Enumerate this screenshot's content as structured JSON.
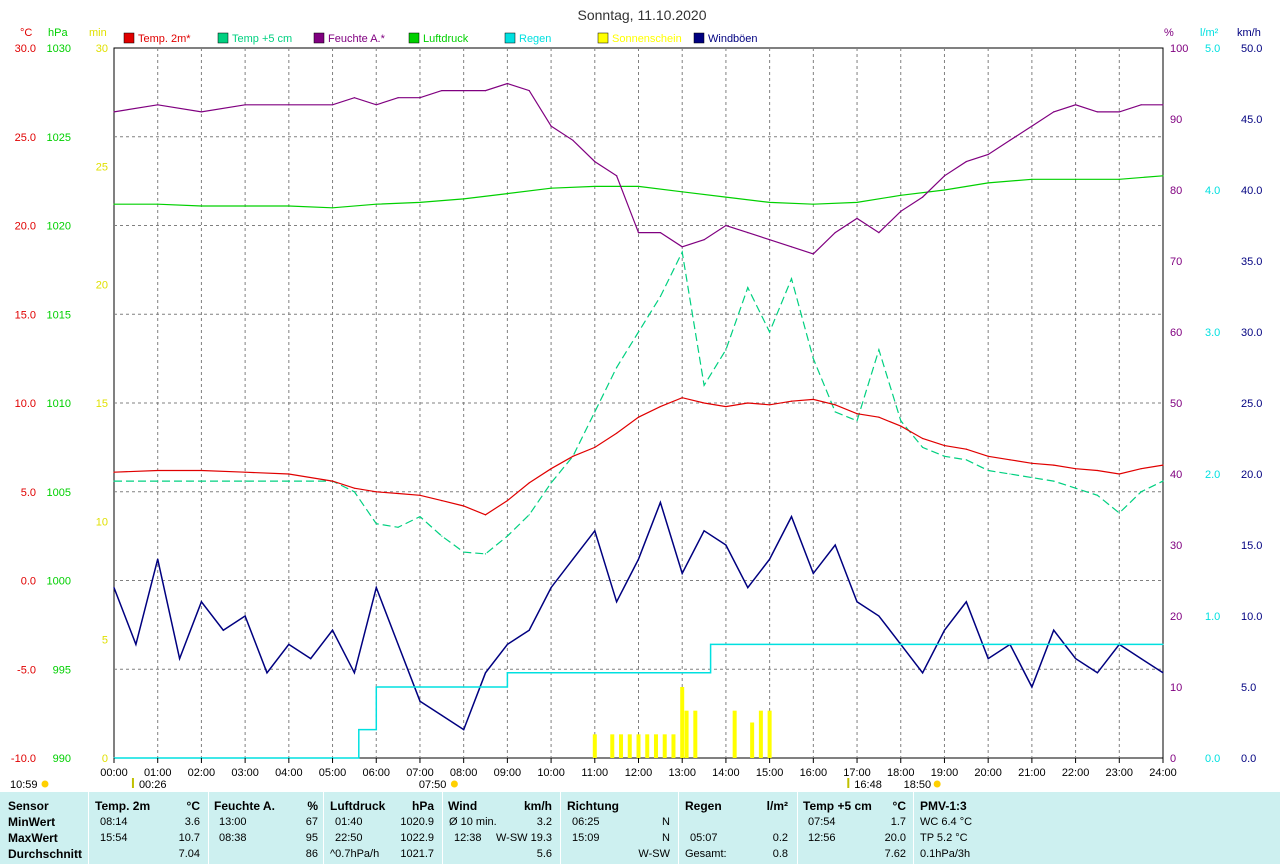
{
  "title": "Sonntag, 11.10.2020",
  "colors": {
    "temp2m": "#e00000",
    "temp5cm": "#00d080",
    "humidity": "#800080",
    "pressure": "#00d000",
    "rain": "#00e0e0",
    "sunshine": "#ffff00",
    "gusts": "#000080",
    "grid": "#808080"
  },
  "axis_units": {
    "temp": "°C",
    "pressure": "hPa",
    "sun": "min",
    "humidity": "%",
    "rain": "l/m²",
    "wind": "km/h"
  },
  "legend": [
    {
      "label": "Temp. 2m*",
      "color": "#e00000"
    },
    {
      "label": "Temp +5 cm",
      "color": "#00d080"
    },
    {
      "label": "Feuchte A.*",
      "color": "#800080"
    },
    {
      "label": "Luftdruck",
      "color": "#00d000"
    },
    {
      "label": "Regen",
      "color": "#00e0e0"
    },
    {
      "label": "Sonnenschein",
      "color": "#ffff00"
    },
    {
      "label": "Windböen",
      "color": "#000080"
    }
  ],
  "chart_data": {
    "type": "line",
    "title": "Sonntag, 11.10.2020",
    "x_ticks": [
      "00:00",
      "01:00",
      "02:00",
      "03:00",
      "04:00",
      "05:00",
      "06:00",
      "07:00",
      "08:00",
      "09:00",
      "10:00",
      "11:00",
      "12:00",
      "13:00",
      "14:00",
      "15:00",
      "16:00",
      "17:00",
      "18:00",
      "19:00",
      "20:00",
      "21:00",
      "22:00",
      "23:00",
      "24:00"
    ],
    "xlim_hours": [
      0,
      24
    ],
    "axes": {
      "temp": {
        "range": [
          -10,
          30
        ],
        "ticks": [
          "30.0",
          "25.0",
          "20.0",
          "15.0",
          "10.0",
          "5.0",
          "0.0",
          "-5.0",
          "-10.0"
        ]
      },
      "pressure": {
        "range": [
          990,
          1030
        ],
        "ticks": [
          "1030",
          "1025",
          "1020",
          "1015",
          "1010",
          "1005",
          "1000",
          "995",
          "990"
        ]
      },
      "sun": {
        "range": [
          0,
          30
        ],
        "ticks": [
          "30",
          "25",
          "20",
          "15",
          "10",
          "5",
          "0"
        ]
      },
      "humidity": {
        "range": [
          0,
          100
        ],
        "ticks": [
          "100",
          "90",
          "80",
          "70",
          "60",
          "50",
          "40",
          "30",
          "20",
          "10",
          "0"
        ]
      },
      "rain": {
        "range": [
          0,
          5
        ],
        "ticks": [
          "5.0",
          "4.0",
          "3.0",
          "2.0",
          "1.0",
          "0.0"
        ]
      },
      "wind": {
        "range": [
          0,
          50
        ],
        "ticks": [
          "50.0",
          "45.0",
          "40.0",
          "35.0",
          "30.0",
          "25.0",
          "20.0",
          "15.0",
          "10.0",
          "5.0",
          "0.0"
        ]
      }
    },
    "grid": true,
    "sun_markers": {
      "sunrise": "07:50",
      "sunset": "18:50",
      "moonrise_left": "00:26",
      "moonset": "16:48",
      "daylength": "10:59"
    },
    "series": [
      {
        "name": "Temp. 2m*",
        "axis": "temp",
        "hours": [
          0,
          1,
          2,
          3,
          4,
          5,
          5.5,
          6,
          6.5,
          7,
          7.5,
          8,
          8.5,
          9,
          9.5,
          10,
          10.5,
          11,
          11.5,
          12,
          12.5,
          13,
          13.5,
          14,
          14.5,
          15,
          15.5,
          16,
          16.5,
          17,
          17.5,
          18,
          18.5,
          19,
          19.5,
          20,
          20.5,
          21,
          21.5,
          22,
          22.5,
          23,
          23.5,
          24
        ],
        "values": [
          6.1,
          6.2,
          6.2,
          6.1,
          6.0,
          5.6,
          5.2,
          5.0,
          4.9,
          4.8,
          4.5,
          4.2,
          3.7,
          4.5,
          5.5,
          6.3,
          7.0,
          7.5,
          8.3,
          9.2,
          9.8,
          10.3,
          10.0,
          9.8,
          10.0,
          9.9,
          10.1,
          10.2,
          9.9,
          9.4,
          9.2,
          8.7,
          8.0,
          7.6,
          7.4,
          7.0,
          6.8,
          6.6,
          6.5,
          6.3,
          6.2,
          6.0,
          6.3,
          6.5
        ]
      },
      {
        "name": "Temp +5 cm",
        "axis": "temp",
        "hours": [
          0,
          1,
          2,
          3,
          4,
          5,
          5.5,
          6,
          6.5,
          7,
          7.5,
          8,
          8.5,
          9,
          9.5,
          10,
          10.5,
          11,
          11.5,
          12,
          12.5,
          13,
          13.5,
          14,
          14.5,
          15,
          15.5,
          16,
          16.5,
          17,
          17.5,
          18,
          18.5,
          19,
          19.5,
          20,
          20.5,
          21,
          21.5,
          22,
          22.5,
          23,
          23.5,
          24
        ],
        "values": [
          5.6,
          5.6,
          5.6,
          5.6,
          5.6,
          5.6,
          5.0,
          3.2,
          3.0,
          3.6,
          2.5,
          1.6,
          1.5,
          2.5,
          3.7,
          5.5,
          7.0,
          9.5,
          12.0,
          14.0,
          16.0,
          18.5,
          11.0,
          13.0,
          16.5,
          14.0,
          17.0,
          12.5,
          9.5,
          9.0,
          13.0,
          9.0,
          7.5,
          7.0,
          6.8,
          6.2,
          6.0,
          5.8,
          5.6,
          5.2,
          4.8,
          3.8,
          5.0,
          5.6
        ]
      },
      {
        "name": "Feuchte A.*",
        "axis": "humidity",
        "hours": [
          0,
          1,
          2,
          3,
          4,
          5,
          5.5,
          6,
          6.5,
          7,
          7.5,
          8,
          8.5,
          9,
          9.5,
          10,
          10.5,
          11,
          11.5,
          12,
          12.5,
          13,
          13.5,
          14,
          14.5,
          15,
          15.5,
          16,
          16.5,
          17,
          17.5,
          18,
          18.5,
          19,
          19.5,
          20,
          20.5,
          21,
          21.5,
          22,
          22.5,
          23,
          23.5,
          24
        ],
        "values": [
          91,
          92,
          91,
          92,
          92,
          92,
          93,
          92,
          93,
          93,
          94,
          94,
          94,
          95,
          94,
          89,
          87,
          84,
          82,
          74,
          74,
          72,
          73,
          75,
          74,
          73,
          72,
          71,
          74,
          76,
          74,
          77,
          79,
          82,
          84,
          85,
          87,
          89,
          91,
          92,
          91,
          91,
          92,
          92
        ]
      },
      {
        "name": "Luftdruck",
        "axis": "pressure",
        "hours": [
          0,
          1,
          2,
          3,
          4,
          5,
          6,
          7,
          8,
          9,
          10,
          11,
          12,
          13,
          14,
          15,
          16,
          17,
          18,
          19,
          20,
          21,
          22,
          23,
          24
        ],
        "values": [
          1021.2,
          1021.2,
          1021.1,
          1021.1,
          1021.1,
          1021.0,
          1021.2,
          1021.3,
          1021.5,
          1021.8,
          1022.1,
          1022.2,
          1022.2,
          1021.9,
          1021.6,
          1021.3,
          1021.2,
          1021.3,
          1021.7,
          1022.0,
          1022.4,
          1022.6,
          1022.6,
          1022.6,
          1022.8
        ]
      },
      {
        "name": "Regen",
        "axis": "rain",
        "hours": [
          0,
          5,
          5.6,
          6.0,
          7.0,
          8.0,
          9.0,
          10.0,
          11.0,
          12.0,
          13.0,
          13.6,
          13.65,
          14,
          15,
          16,
          17,
          18,
          19,
          20,
          21,
          22,
          23,
          24
        ],
        "values": [
          0,
          0,
          0.2,
          0.5,
          0.5,
          0.5,
          0.6,
          0.6,
          0.6,
          0.6,
          0.6,
          0.6,
          0.8,
          0.8,
          0.8,
          0.8,
          0.8,
          0.8,
          0.8,
          0.8,
          0.8,
          0.8,
          0.8,
          0.8
        ]
      },
      {
        "name": "Sonnenschein",
        "axis": "sun",
        "type": "bar",
        "hours": [
          11.0,
          11.4,
          11.6,
          11.8,
          12.0,
          12.2,
          12.4,
          12.6,
          12.8,
          13.0,
          13.1,
          13.3,
          14.2,
          14.6,
          14.8,
          15.0
        ],
        "values": [
          1.0,
          1.0,
          1.0,
          1.0,
          1.0,
          1.0,
          1.0,
          1.0,
          1.0,
          3.0,
          2.0,
          2.0,
          2.0,
          1.5,
          2.0,
          2.0
        ]
      },
      {
        "name": "Windböen",
        "axis": "wind",
        "hours": [
          0,
          0.5,
          1,
          1.5,
          2,
          2.5,
          3,
          3.5,
          4,
          4.5,
          5,
          5.5,
          6,
          6.5,
          7,
          7.5,
          8,
          8.5,
          9,
          9.5,
          10,
          10.5,
          11,
          11.5,
          12,
          12.5,
          13,
          13.5,
          14,
          14.5,
          15,
          15.5,
          16,
          16.5,
          17,
          17.5,
          18,
          18.5,
          19,
          19.5,
          20,
          20.5,
          21,
          21.5,
          22,
          22.5,
          23,
          23.5,
          24
        ],
        "values": [
          12,
          8,
          14,
          7,
          11,
          9,
          10,
          6,
          8,
          7,
          9,
          6,
          12,
          8,
          4,
          3,
          2,
          6,
          8,
          9,
          12,
          14,
          16,
          11,
          14,
          18,
          13,
          16,
          15,
          12,
          14,
          17,
          13,
          15,
          11,
          10,
          8,
          6,
          9,
          11,
          7,
          8,
          5,
          9,
          7,
          6,
          8,
          7,
          6
        ]
      }
    ]
  },
  "stats": {
    "headers": {
      "sensor": "Sensor",
      "temp": "Temp. 2m",
      "temp_u": "°C",
      "hum": "Feuchte A.",
      "hum_u": "%",
      "pres": "Luftdruck",
      "pres_u": "hPa",
      "wind": "Wind",
      "wind_u": "km/h",
      "dir": "Richtung",
      "rain": "Regen",
      "rain_u": "l/m²",
      "t5": "Temp +5 cm",
      "t5_u": "°C",
      "pmv": "PMV-1:3"
    },
    "row_labels": {
      "min": "MinWert",
      "max": "MaxWert",
      "avg": "Durchschnitt"
    },
    "temp": {
      "min_t": "08:14",
      "min": "3.6",
      "max_t": "15:54",
      "max": "10.7",
      "avg": "7.04"
    },
    "hum": {
      "min_t": "13:00",
      "min": "67",
      "max_t": "08:38",
      "max": "95",
      "avg": "86"
    },
    "pres": {
      "min_t": "01:40",
      "min": "1020.9",
      "max_t": "22:50",
      "max": "1022.9",
      "avg_l": "^0.7hPa/h",
      "avg": "1021.7"
    },
    "wind": {
      "min_l": "Ø 10 min.",
      "min": "3.2",
      "max_t": "12:38",
      "max_l": "W-SW",
      "max": "19.3",
      "avg": "5.6"
    },
    "dir": {
      "min_t": "06:25",
      "min": "N",
      "max_t": "15:09",
      "max": "N",
      "avg": "W-SW"
    },
    "rain": {
      "max_t": "05:07",
      "max": "0.2",
      "avg_l": "Gesamt:",
      "avg": "0.8"
    },
    "t5": {
      "min_t": "07:54",
      "min": "1.7",
      "max_t": "12:56",
      "max": "20.0",
      "avg": "7.62"
    },
    "pmv": {
      "min": "WC 6.4 °C",
      "max": "TP 5.2 °C",
      "avg": "0.1hPa/3h"
    }
  }
}
